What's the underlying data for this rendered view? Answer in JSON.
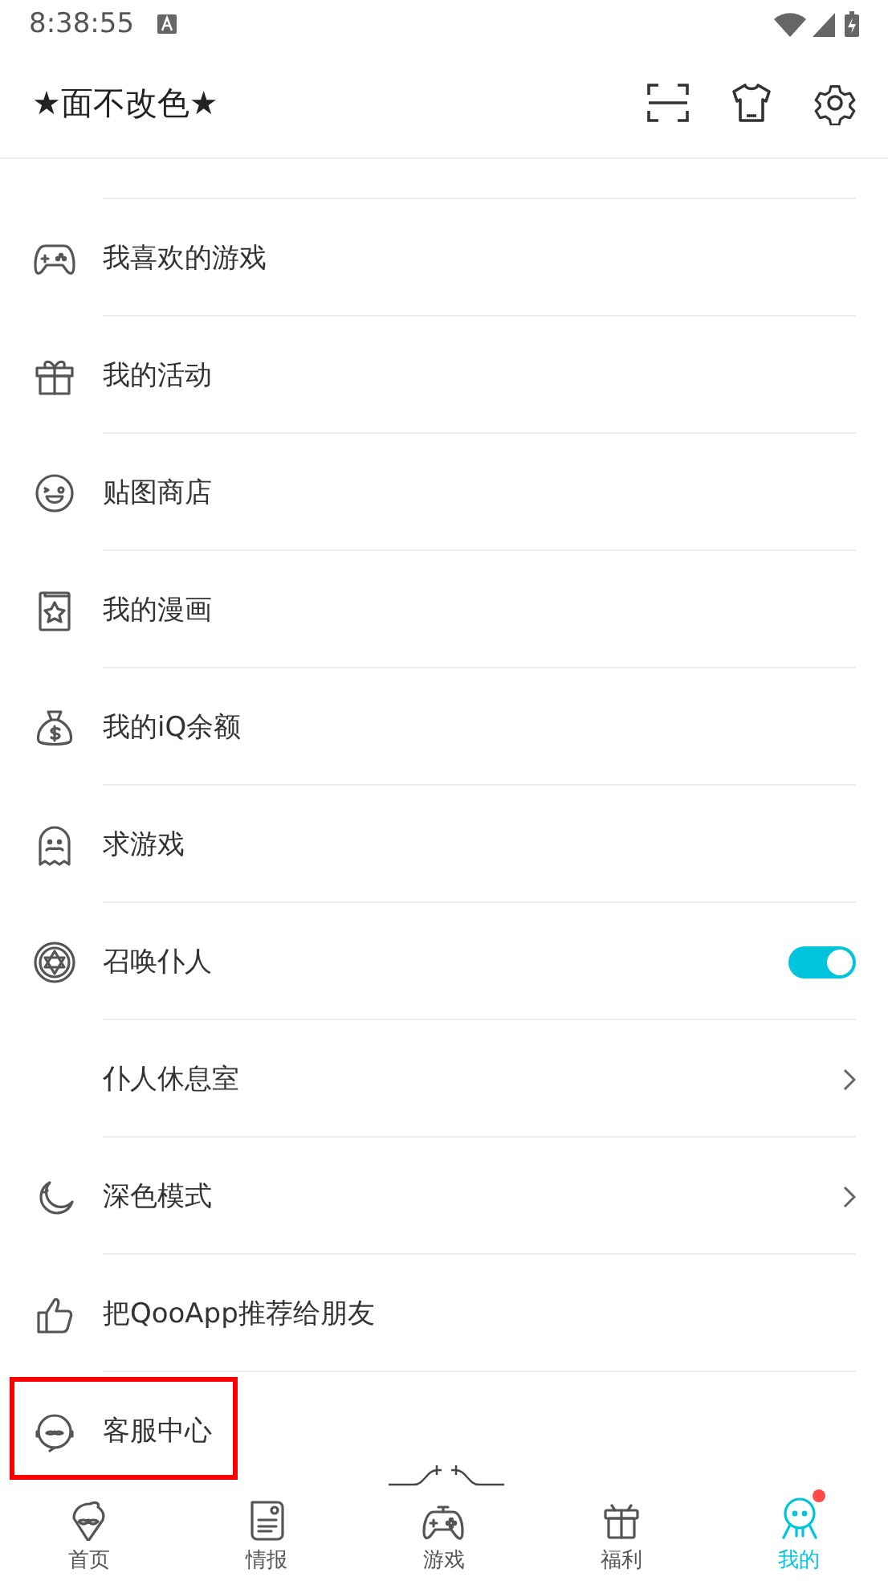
{
  "status_bar": {
    "time": "8:38:55"
  },
  "header": {
    "title": "★面不改色★"
  },
  "rows": [
    {
      "label": "我喜欢的游戏",
      "kind": "plain"
    },
    {
      "label": "我的活动",
      "kind": "plain"
    },
    {
      "label": "贴图商店",
      "kind": "plain"
    },
    {
      "label": "我的漫画",
      "kind": "plain"
    },
    {
      "label": "我的iQ余额",
      "kind": "plain"
    },
    {
      "label": "求游戏",
      "kind": "plain"
    },
    {
      "label": "召唤仆人",
      "kind": "toggle",
      "on": true
    },
    {
      "label": "仆人休息室",
      "kind": "chevron"
    },
    {
      "label": "深色模式",
      "kind": "chevron"
    },
    {
      "label": "把QooApp推荐给朋友",
      "kind": "plain"
    },
    {
      "label": "客服中心",
      "kind": "plain",
      "highlighted": true
    }
  ],
  "nav": [
    {
      "label": "首页",
      "selected": false,
      "badge": false
    },
    {
      "label": "情报",
      "selected": false,
      "badge": false
    },
    {
      "label": "游戏",
      "selected": false,
      "badge": false
    },
    {
      "label": "福利",
      "selected": false,
      "badge": false
    },
    {
      "label": "我的",
      "selected": true,
      "badge": true
    }
  ]
}
